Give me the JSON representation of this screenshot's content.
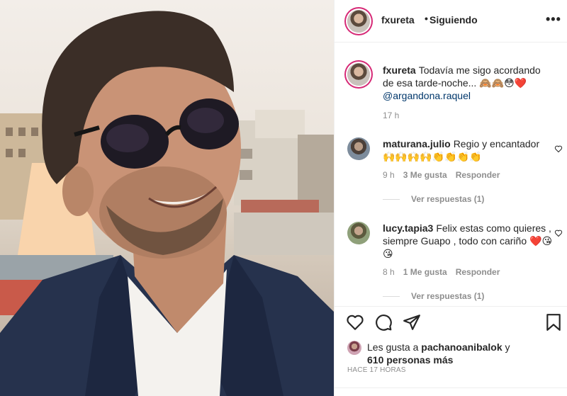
{
  "post": {
    "username": "fxureta",
    "separator": "•",
    "follow_status": "Siguiendo",
    "more_icon": "more-horizontal-icon"
  },
  "caption": {
    "username": "fxureta",
    "text": "Todavía me sigo acordando de esa tarde-noche... 🙈🙈😳❤️",
    "mention": "@argandona.raquel",
    "time": "17 h"
  },
  "comments": [
    {
      "username": "maturana.julio",
      "text": "Regio y encantador 🙌🙌🙌🙌👏👏👏👏",
      "time": "9 h",
      "likes": "3 Me gusta",
      "reply": "Responder",
      "view_replies": "Ver respuestas (1)"
    },
    {
      "username": "lucy.tapia3",
      "text": "Felix estas como quieres , siempre Guapo , todo con cariño ❤️😘😘",
      "time": "8 h",
      "likes": "1 Me gusta",
      "reply": "Responder",
      "view_replies": "Ver respuestas (1)"
    }
  ],
  "likes": {
    "prefix": "Les gusta a",
    "user": "pachanoanibalok",
    "connector": "y",
    "others": "610 personas más"
  },
  "time_ago": "HACE 17 HORAS",
  "icons": {
    "like": "heart-icon",
    "comment": "comment-icon",
    "share": "paper-plane-icon",
    "save": "bookmark-icon"
  },
  "colors": {
    "text": "#262626",
    "secondary": "#8e8e8e",
    "mention": "#00376b",
    "story_ring": "#d62976",
    "border": "#efefef"
  }
}
